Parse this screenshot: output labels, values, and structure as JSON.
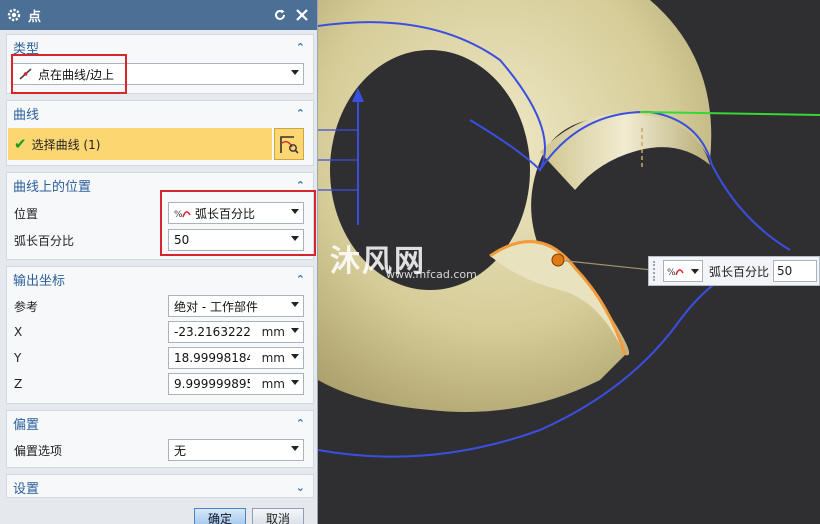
{
  "dialog": {
    "title": "点"
  },
  "sections": {
    "type": {
      "header": "类型",
      "dropdown_value": "点在曲线/边上"
    },
    "curve": {
      "header": "曲线",
      "select_label": "选择曲线 (1)"
    },
    "position": {
      "header": "曲线上的位置",
      "location_label": "位置",
      "location_value": "弧长百分比",
      "arc_label": "弧长百分比",
      "arc_value": "50"
    },
    "output": {
      "header": "输出坐标",
      "reference_label": "参考",
      "reference_value": "绝对 - 工作部件",
      "x_label": "X",
      "x_value": "-23.21632223",
      "y_label": "Y",
      "y_value": "18.99998184",
      "z_label": "Z",
      "z_value": "9.999999895",
      "unit": "mm"
    },
    "offset": {
      "header": "偏置",
      "option_label": "偏置选项",
      "option_value": "无"
    },
    "settings": {
      "header": "设置"
    }
  },
  "buttons": {
    "ok": "确定",
    "cancel": "取消"
  },
  "float_toolbar": {
    "label": "弧长百分比",
    "value": "50"
  },
  "watermark": {
    "main": "沐风网",
    "sub": "www.mfcad.com"
  },
  "colors": {
    "titlebar": "#4c6f96",
    "section_header": "#2b5f9a",
    "selection_highlight": "#fbd671",
    "annotation_red": "#d6262c",
    "torus": "#d8cf9e",
    "curve_blue": "#3a4fe0",
    "selected_edge": "#f39a3a"
  }
}
